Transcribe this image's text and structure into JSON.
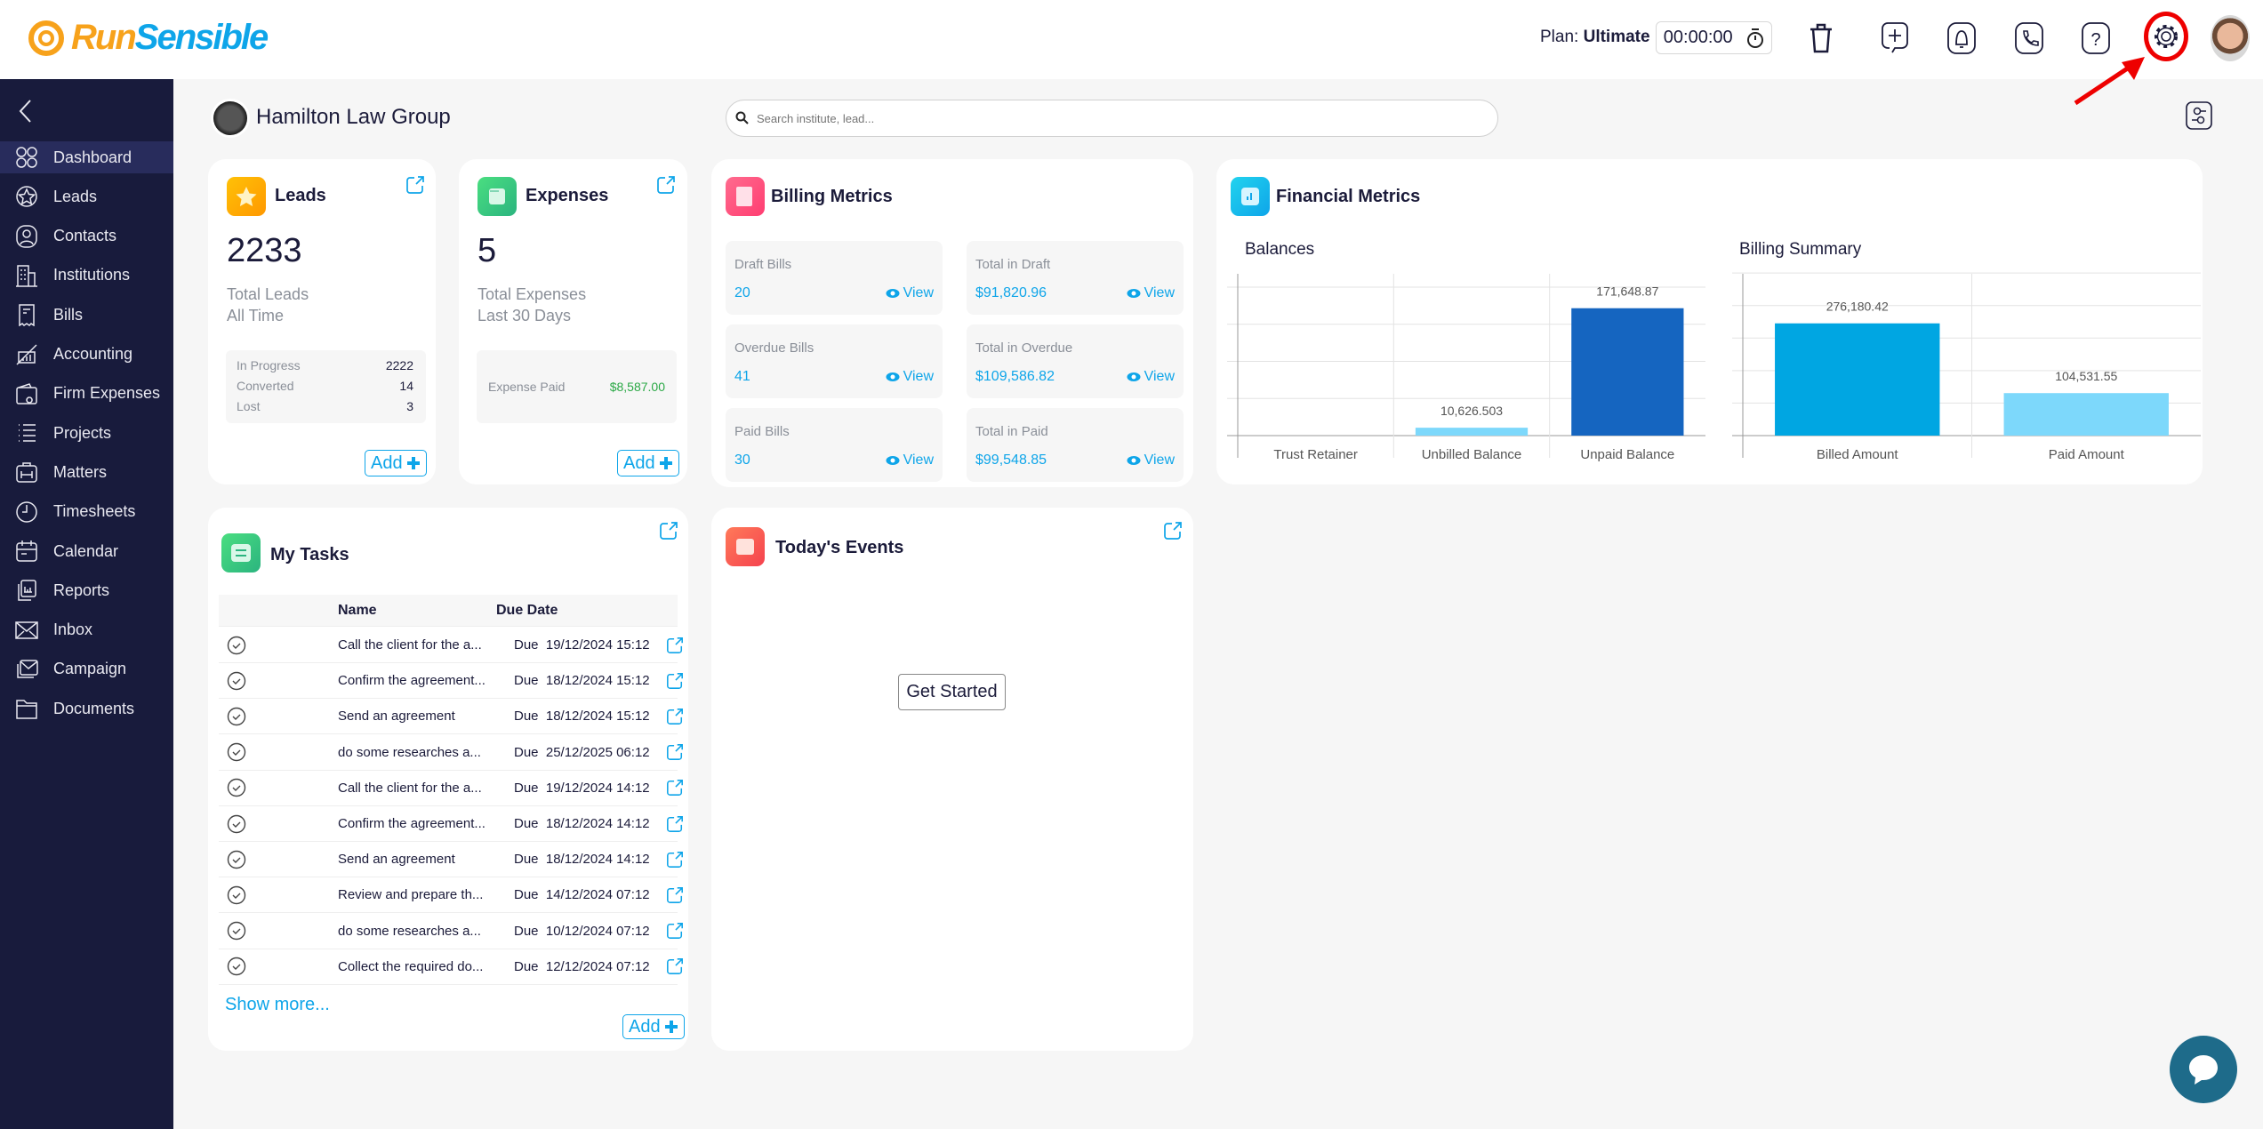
{
  "header": {
    "logo_run": "Run",
    "logo_sensible": "Sensible",
    "plan_label": "Plan:",
    "plan_value": "Ultimate",
    "timer": "00:00:00",
    "icons": [
      "stopwatch-icon",
      "trash-icon",
      "add-task-icon",
      "bell-icon",
      "phone-icon",
      "help-icon",
      "gear-icon"
    ],
    "highlight_color": "#ee0000"
  },
  "sidebar": {
    "items": [
      {
        "label": "Dashboard",
        "icon": "dashboard-icon",
        "active": true
      },
      {
        "label": "Leads",
        "icon": "star-icon"
      },
      {
        "label": "Contacts",
        "icon": "user-icon"
      },
      {
        "label": "Institutions",
        "icon": "building-icon"
      },
      {
        "label": "Bills",
        "icon": "receipt-icon"
      },
      {
        "label": "Accounting",
        "icon": "chart-icon"
      },
      {
        "label": "Firm Expenses",
        "icon": "wallet-icon"
      },
      {
        "label": "Projects",
        "icon": "list-icon"
      },
      {
        "label": "Matters",
        "icon": "briefcase-icon"
      },
      {
        "label": "Timesheets",
        "icon": "clock-icon"
      },
      {
        "label": "Calendar",
        "icon": "calendar-icon"
      },
      {
        "label": "Reports",
        "icon": "report-icon"
      },
      {
        "label": "Inbox",
        "icon": "mail-icon"
      },
      {
        "label": "Campaign",
        "icon": "campaign-icon"
      },
      {
        "label": "Documents",
        "icon": "folder-icon"
      }
    ]
  },
  "org": {
    "name": "Hamilton Law Group"
  },
  "search": {
    "placeholder": "Search institute, lead..."
  },
  "leads": {
    "title": "Leads",
    "count": "2233",
    "sub1": "Total Leads",
    "sub2": "All Time",
    "stats": [
      {
        "label": "In Progress",
        "value": "2222"
      },
      {
        "label": "Converted",
        "value": "14"
      },
      {
        "label": "Lost",
        "value": "3"
      }
    ],
    "add": "Add"
  },
  "expenses": {
    "title": "Expenses",
    "count": "5",
    "sub1": "Total Expenses",
    "sub2": "Last 30 Days",
    "paid_label": "Expense Paid",
    "paid_value": "$8,587.00",
    "add": "Add"
  },
  "billing": {
    "title": "Billing Metrics",
    "view": "View",
    "items": [
      {
        "label": "Draft Bills",
        "value": "20"
      },
      {
        "label": "Total in Draft",
        "value": "$91,820.96"
      },
      {
        "label": "Overdue Bills",
        "value": "41"
      },
      {
        "label": "Total in Overdue",
        "value": "$109,586.82"
      },
      {
        "label": "Paid Bills",
        "value": "30"
      },
      {
        "label": "Total in Paid",
        "value": "$99,548.85"
      }
    ]
  },
  "financial": {
    "title": "Financial Metrics"
  },
  "chart_data": [
    {
      "type": "bar",
      "title": "Balances",
      "categories": [
        "Trust Retainer",
        "Unbilled Balance",
        "Unpaid Balance"
      ],
      "values": [
        0,
        10626.503,
        171648.87
      ],
      "labels": [
        "",
        "10,626.503",
        "171,648.87"
      ],
      "colors": [
        "#7dd8fb",
        "#7dd8fb",
        "#1565c0"
      ],
      "ylim": [
        0,
        230000
      ],
      "grid": true
    },
    {
      "type": "bar",
      "title": "Billing Summary",
      "categories": [
        "Billed Amount",
        "Paid Amount"
      ],
      "values": [
        276180.42,
        104531.55
      ],
      "labels": [
        "276,180.42",
        "104,531.55"
      ],
      "colors": [
        "#00a6e2",
        "#7dd8fb"
      ],
      "ylim": [
        0,
        420000
      ],
      "grid": true
    }
  ],
  "tasks": {
    "title": "My Tasks",
    "col_name": "Name",
    "col_due": "Due Date",
    "show_more": "Show more...",
    "add": "Add",
    "rows": [
      {
        "name": "Call the client for the a...",
        "due": "Due  19/12/2024 15:12"
      },
      {
        "name": "Confirm the agreement...",
        "due": "Due  18/12/2024 15:12"
      },
      {
        "name": "Send an agreement",
        "due": "Due  18/12/2024 15:12"
      },
      {
        "name": "do some researches a...",
        "due": "Due  25/12/2025 06:12"
      },
      {
        "name": "Call the client for the a...",
        "due": "Due  19/12/2024 14:12"
      },
      {
        "name": "Confirm the agreement...",
        "due": "Due  18/12/2024 14:12"
      },
      {
        "name": "Send an agreement",
        "due": "Due  18/12/2024 14:12"
      },
      {
        "name": "Review and prepare th...",
        "due": "Due  14/12/2024 07:12"
      },
      {
        "name": "do some researches a...",
        "due": "Due  10/12/2024 07:12"
      },
      {
        "name": "Collect the required do...",
        "due": "Due  12/12/2024 07:12"
      }
    ]
  },
  "events": {
    "title": "Today's Events",
    "get_started": "Get Started"
  }
}
